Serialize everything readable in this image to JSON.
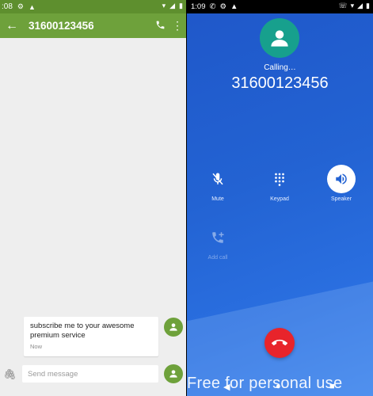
{
  "left": {
    "status": {
      "time": ":08"
    },
    "toolbar": {
      "title": "31600123456"
    },
    "message": {
      "text": "subscribe me to your awesome premium service",
      "time": "Now"
    },
    "compose": {
      "placeholder": "Send message"
    }
  },
  "right": {
    "status": {
      "time": "1:09"
    },
    "call": {
      "status": "Calling…",
      "number": "31600123456"
    },
    "controls": [
      {
        "label": "Mute",
        "icon": "mic-off-icon"
      },
      {
        "label": "Keypad",
        "icon": "dialpad-icon"
      },
      {
        "label": "Speaker",
        "icon": "speaker-icon",
        "active": true
      },
      {
        "label": "Add call",
        "icon": "add-call-icon",
        "disabled": true
      }
    ]
  },
  "watermark": "Free for personal use",
  "colors": {
    "sms_toolbar": "#6ea13b",
    "sms_status": "#5e8f2e",
    "dialer_bg": "#2363d3",
    "avatar": "#17a08d",
    "end_call": "#e8242b"
  }
}
